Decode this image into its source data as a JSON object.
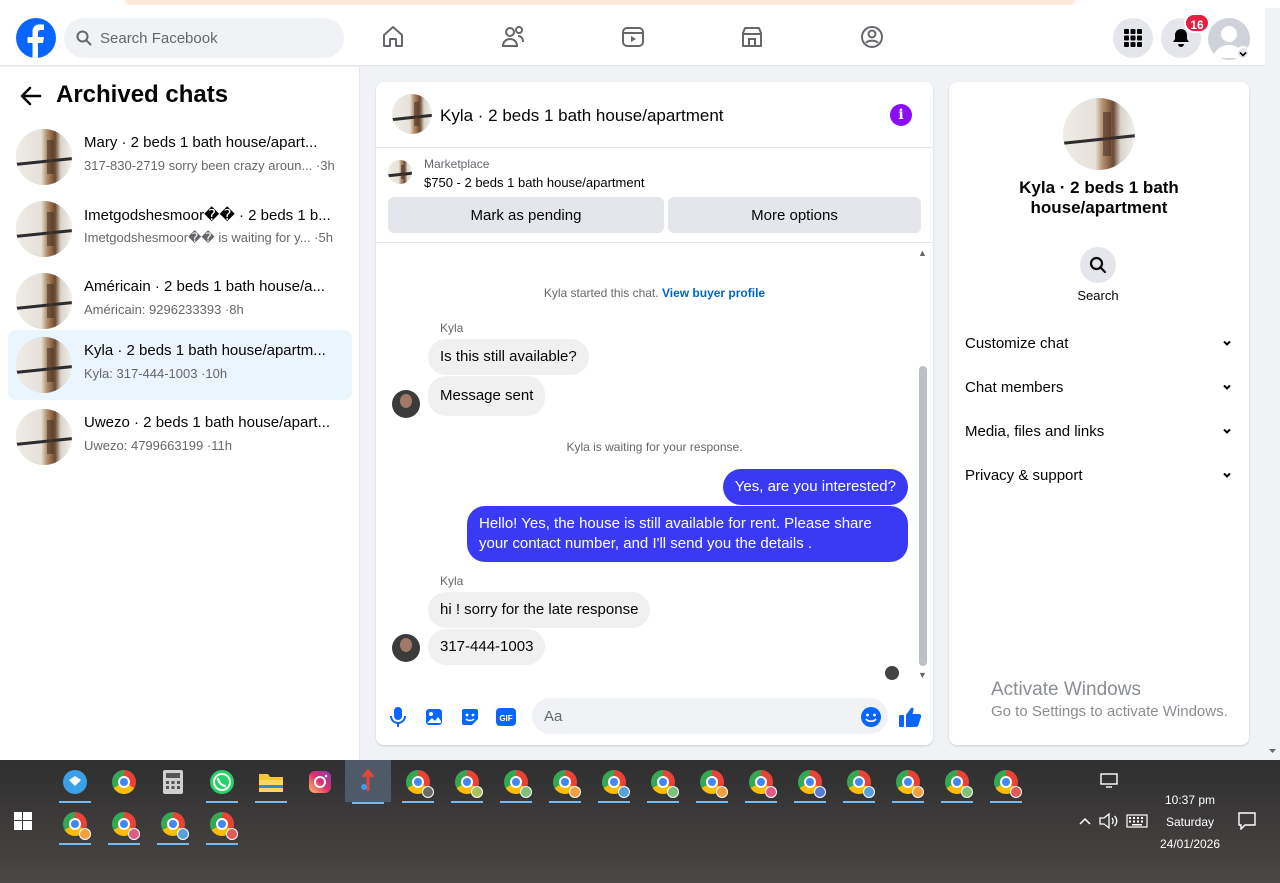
{
  "header": {
    "search_placeholder": "Search Facebook",
    "notification_count": "16"
  },
  "sidebar": {
    "title": "Archived chats",
    "chats": [
      {
        "name": "Mary · 2 beds 1 bath house/apart...",
        "preview": "317-830-2719 sorry been crazy aroun... ·3h",
        "active": false
      },
      {
        "name": "Imetgodshesmoor�� · 2 beds 1 b...",
        "preview": "Imetgodshesmoor�� is waiting for y... ·5h",
        "active": false
      },
      {
        "name": "Américain · 2 beds 1 bath house/a...",
        "preview": "Américain: 9296233393 ·8h",
        "active": false
      },
      {
        "name": "Kyla · 2 beds 1 bath house/apartm...",
        "preview": "Kyla: 317-444-1003 ·10h",
        "active": true
      },
      {
        "name": "Uwezo · 2 beds 1 bath house/apart...",
        "preview": "Uwezo: 4799663199 ·11h",
        "active": false
      }
    ]
  },
  "chat": {
    "title": "Kyla · 2 beds 1 bath house/apartment",
    "marketplace_label": "Marketplace",
    "listing": "$750 - 2 beds 1 bath house/apartment",
    "mark_pending": "Mark as pending",
    "more_options": "More options",
    "started_text": "Kyla started this chat.",
    "buyer_profile_link": "View buyer profile",
    "sender_name_1": "Kyla",
    "msg_1": "Is this still available?",
    "msg_2": "Message sent",
    "waiting_text": "Kyla is waiting for your response.",
    "msg_3": "Yes, are you interested?",
    "msg_4": "Hello! Yes, the house is still available for rent. Please share your contact number, and I'll send you the details .",
    "sender_name_2": "Kyla",
    "msg_5": "hi ! sorry for the late response",
    "msg_6": "317-444-1003",
    "input_placeholder": "Aa"
  },
  "info_panel": {
    "name": "Kyla · 2 beds 1 bath house/apartment",
    "search_label": "Search",
    "sections": [
      "Customize chat",
      "Chat members",
      "Media, files and links",
      "Privacy & support"
    ]
  },
  "watermark": {
    "line1": "Activate Windows",
    "line2": "Go to Settings to activate Windows."
  },
  "tray": {
    "time": "10:37 pm",
    "day": "Saturday",
    "date": "24/01/2026"
  },
  "colors": {
    "brand": "#0866ff",
    "outgoing_bubble": "#3a3af5",
    "active_chat": "#ebf5ff",
    "notification": "#e41e3f"
  }
}
